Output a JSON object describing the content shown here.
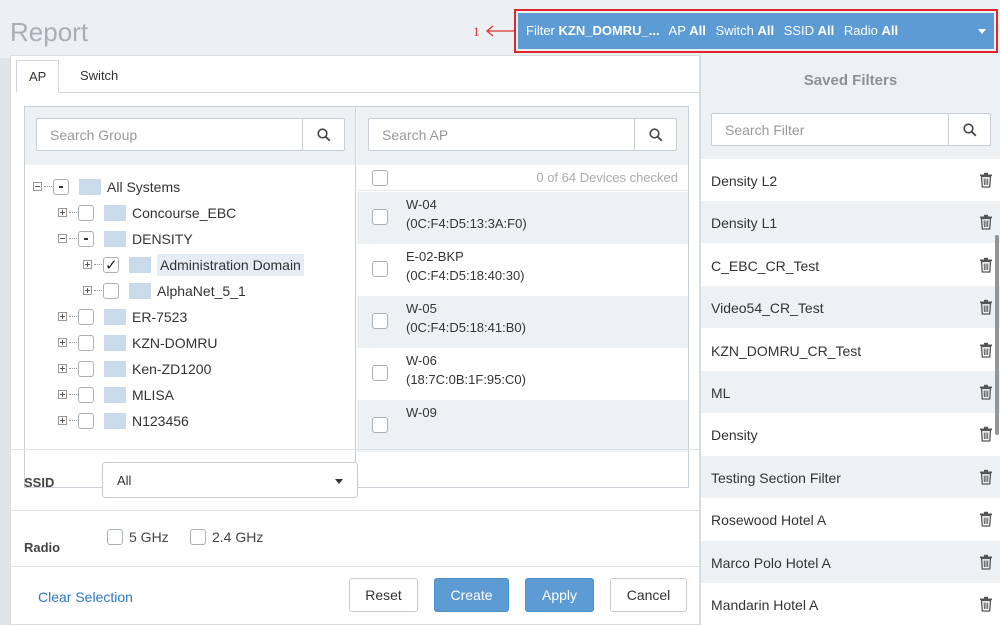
{
  "header": {
    "title": "Report",
    "callout": "1"
  },
  "filter_bar": {
    "filter_label": "Filter",
    "filter_value": "KZN_DOMRU_...",
    "ap_label": "AP",
    "ap_value": "All",
    "switch_label": "Switch",
    "switch_value": "All",
    "ssid_label": "SSID",
    "ssid_value": "All",
    "radio_label": "Radio",
    "radio_value": "All"
  },
  "tabs": [
    {
      "label": "AP"
    },
    {
      "label": "Switch"
    }
  ],
  "group_search": {
    "placeholder": "Search Group"
  },
  "ap_search": {
    "placeholder": "Search AP"
  },
  "tree": [
    {
      "label": "All Systems",
      "state": "partial",
      "expanded": true
    },
    {
      "label": "Concourse_EBC",
      "state": "unchecked",
      "expanded": false
    },
    {
      "label": "DENSITY",
      "state": "partial",
      "expanded": true
    },
    {
      "label": "Administration Domain",
      "state": "checked",
      "expanded": false
    },
    {
      "label": "AlphaNet_5_1",
      "state": "unchecked",
      "expanded": false
    },
    {
      "label": "ER-7523",
      "state": "unchecked",
      "expanded": false
    },
    {
      "label": "KZN-DOMRU",
      "state": "unchecked",
      "expanded": false
    },
    {
      "label": "Ken-ZD1200",
      "state": "unchecked",
      "expanded": false
    },
    {
      "label": "MLISA",
      "state": "unchecked",
      "expanded": false
    },
    {
      "label": "N123456",
      "state": "unchecked",
      "expanded": false
    }
  ],
  "ap_list": {
    "count_text": "0 of 64 Devices checked",
    "items": [
      {
        "name": "W-04",
        "mac": "(0C:F4:D5:13:3A:F0)"
      },
      {
        "name": "E-02-BKP",
        "mac": "(0C:F4:D5:18:40:30)"
      },
      {
        "name": "W-05",
        "mac": "(0C:F4:D5:18:41:B0)"
      },
      {
        "name": "W-06",
        "mac": "(18:7C:0B:1F:95:C0)"
      },
      {
        "name": "W-09",
        "mac": ""
      }
    ]
  },
  "ssid": {
    "label": "SSID",
    "value": "All"
  },
  "radio": {
    "label": "Radio",
    "options": [
      {
        "label": "5 GHz",
        "checked": false
      },
      {
        "label": "2.4 GHz",
        "checked": false
      }
    ]
  },
  "footer": {
    "clear_selection": "Clear Selection",
    "reset": "Reset",
    "create": "Create",
    "apply": "Apply",
    "cancel": "Cancel"
  },
  "saved_filters": {
    "title": "Saved Filters",
    "search_placeholder": "Search Filter",
    "items": [
      "Density L2",
      "Density L1",
      "C_EBC_CR_Test",
      "Video54_CR_Test",
      "KZN_DOMRU_CR_Test",
      "ML",
      "Density",
      "Testing Section Filter",
      "Rosewood Hotel A",
      "Marco Polo Hotel A",
      "Mandarin Hotel A"
    ]
  },
  "colors": {
    "accent": "#5c9bd4",
    "highlight_border": "#e0262b",
    "link": "#2b78c5"
  },
  "icons": {
    "search": "search-icon",
    "trash": "trash-icon",
    "folder": "folder-icon",
    "caret": "chevron-down-icon"
  }
}
